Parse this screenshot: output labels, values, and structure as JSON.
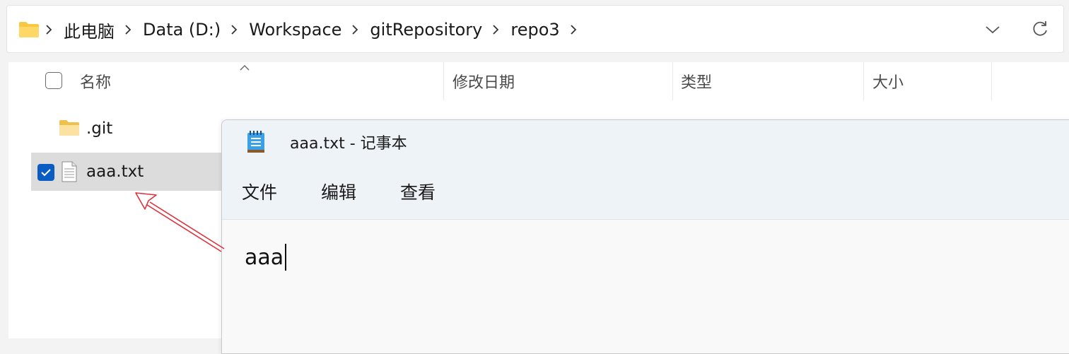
{
  "address_bar": {
    "breadcrumbs": [
      "此电脑",
      "Data (D:)",
      "Workspace",
      "gitRepository",
      "repo3"
    ]
  },
  "columns": {
    "name": "名称",
    "modified": "修改日期",
    "type": "类型",
    "size": "大小"
  },
  "files": [
    {
      "name": ".git",
      "kind": "folder",
      "selected": false
    },
    {
      "name": "aaa.txt",
      "kind": "text-file",
      "selected": true
    }
  ],
  "notepad": {
    "title": "aaa.txt - 记事本",
    "menu": [
      "文件",
      "编辑",
      "查看"
    ],
    "content": "aaa"
  },
  "annotation": {
    "arrow_color": "#e0303a"
  },
  "colors": {
    "folder": "#f8c843",
    "checkbox_accent": "#0a5bc2",
    "selection": "#dcdcdc"
  }
}
